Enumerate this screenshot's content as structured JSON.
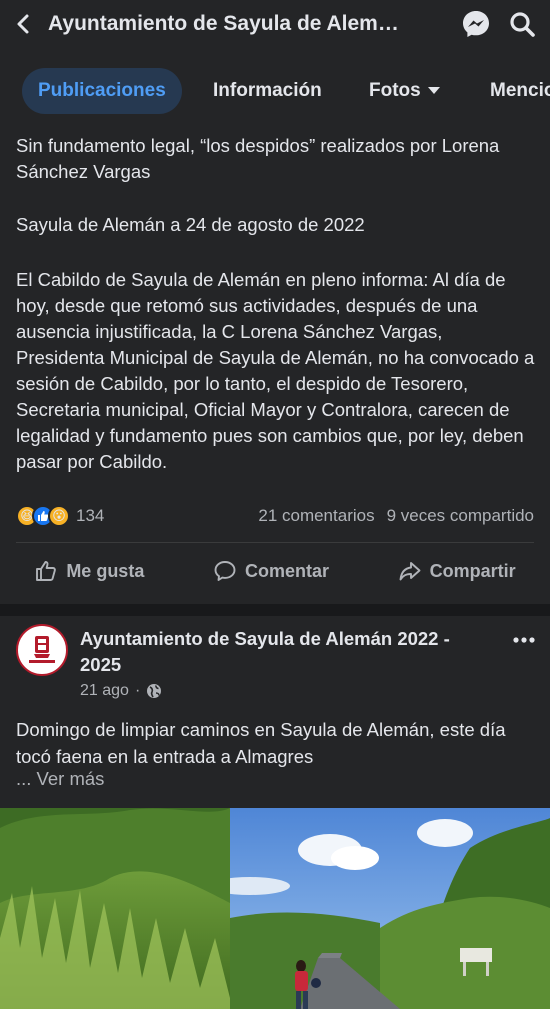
{
  "header": {
    "title": "Ayuntamiento de Sayula de Alem…",
    "back_icon": "chevron-left-icon",
    "messenger_icon": "messenger-icon",
    "search_icon": "search-icon"
  },
  "tabs": [
    {
      "label": "Publicaciones",
      "active": true
    },
    {
      "label": "Información",
      "active": false
    },
    {
      "label": "Fotos",
      "active": false
    },
    {
      "label": "Mencio",
      "active": false
    }
  ],
  "post1": {
    "title_line": "Sin fundamento legal, “los despidos” realizados por Lorena Sánchez Vargas",
    "dateline": "Sayula de Alemán a 24 de agosto de 2022",
    "body": "El Cabildo de Sayula de Alemán en pleno informa: Al día de hoy, desde que retomó sus actividades, después de una ausencia injustificada, la C Lorena Sánchez Vargas, Presidenta Municipal de Sayula de Alemán, no ha convocado a sesión de Cabildo, por lo tanto, el despido de Tesorero, Secretaria municipal, Oficial Mayor y Contralora, carecen de legalidad y fundamento pues son cambios que, por ley, deben pasar por Cabildo.",
    "reaction_count": "134",
    "comments": "21 comentarios",
    "shares": "9 veces compartido",
    "actions": {
      "like": "Me gusta",
      "comment": "Comentar",
      "share": "Compartir"
    }
  },
  "post2": {
    "author": "Ayuntamiento de Sayula de Alemán 2022 - 2025",
    "time": "21 ago",
    "separator": "·",
    "text": "Domingo de limpiar caminos en Sayula de Alemán, este día tocó faena en la entrada a Almagres",
    "see_more": "... Ver más",
    "more_icon": "more-options-icon"
  },
  "colors": {
    "background": "#242527",
    "accent": "#4f9df5",
    "active_tab_bg": "#263951",
    "text": "#e4e6eb",
    "muted": "#b0b3b8"
  }
}
